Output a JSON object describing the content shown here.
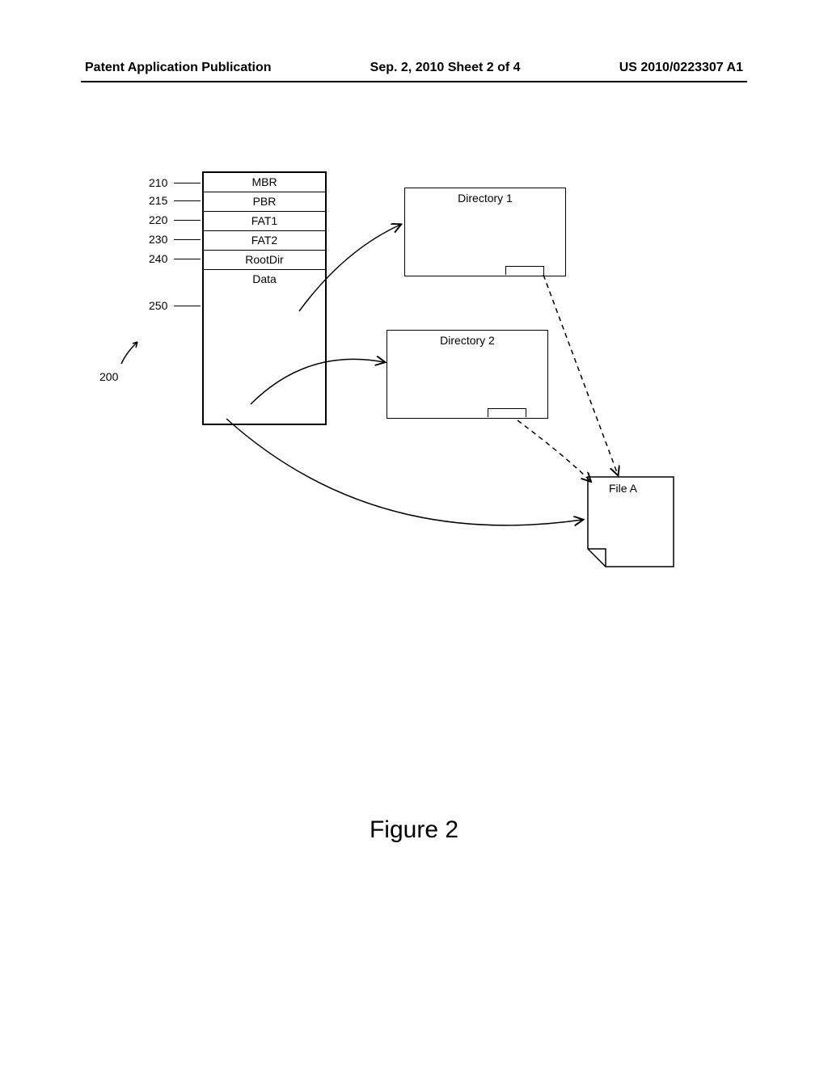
{
  "header": {
    "left": "Patent Application Publication",
    "center": "Sep. 2, 2010  Sheet 2 of 4",
    "right": "US 2010/0223307 A1"
  },
  "stack": {
    "rows": [
      "MBR",
      "PBR",
      "FAT1",
      "FAT2",
      "RootDir"
    ],
    "data_label": "Data"
  },
  "labels": {
    "l210": "210",
    "l215": "215",
    "l220": "220",
    "l230": "230",
    "l240": "240",
    "l250": "250",
    "l200": "200"
  },
  "directories": {
    "dir1": "Directory 1",
    "dir2": "Directory 2"
  },
  "file": {
    "name": "File A"
  },
  "figure_caption": "Figure 2"
}
